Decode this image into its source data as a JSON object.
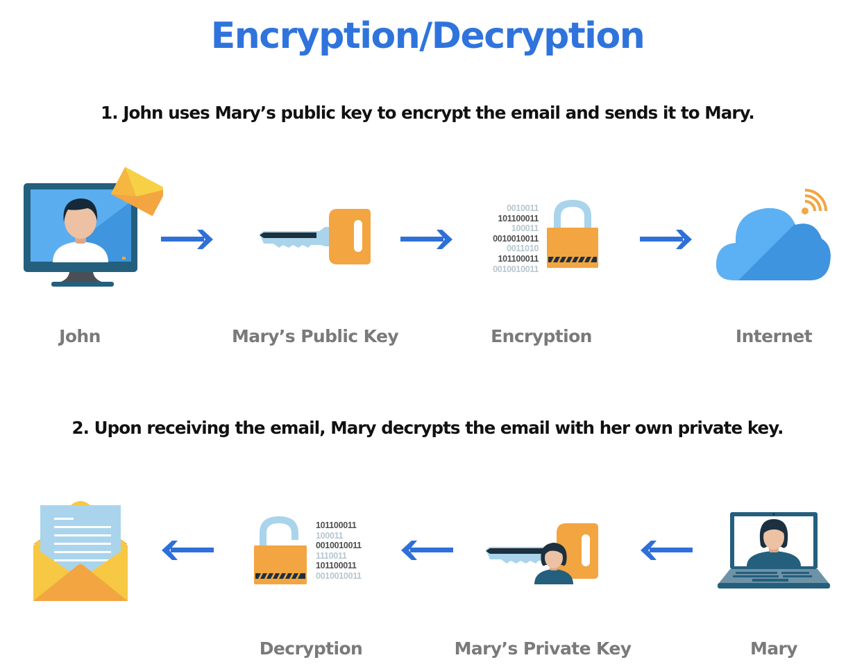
{
  "title": "Encryption/Decryption",
  "colors": {
    "title": "#2f74dc",
    "arrow": "#2f6fd8",
    "label": "#7a7a7a",
    "orange": "#f2a541",
    "yellow": "#f7c843",
    "light_blue": "#a9d4ec",
    "dark_teal": "#245f7d"
  },
  "step1": {
    "text": "1. John uses Mary’s public key to encrypt the email and sends it to Mary.",
    "nodes": [
      {
        "label": "John",
        "icon": "monitor-user-email-icon"
      },
      {
        "label": "Mary’s Public Key",
        "icon": "key-icon"
      },
      {
        "label": "Encryption",
        "icon": "locked-padlock-icon"
      },
      {
        "label": "Internet",
        "icon": "cloud-wifi-icon"
      }
    ],
    "arrow_direction": "right",
    "binary": [
      {
        "text": "0010011",
        "tone": "l"
      },
      {
        "text": "101100011",
        "tone": "d"
      },
      {
        "text": "100011",
        "tone": "l"
      },
      {
        "text": "0010010011",
        "tone": "d"
      },
      {
        "text": "0011010",
        "tone": "l"
      },
      {
        "text": "101100011",
        "tone": "d"
      },
      {
        "text": "0010010011",
        "tone": "l"
      }
    ]
  },
  "step2": {
    "text": "2. Upon receiving the email, Mary decrypts the email with her own private key.",
    "nodes": [
      {
        "label": "",
        "icon": "open-envelope-letter-icon"
      },
      {
        "label": "Decryption",
        "icon": "unlocked-padlock-icon"
      },
      {
        "label": "Mary’s Private Key",
        "icon": "key-with-user-icon"
      },
      {
        "label": "Mary",
        "icon": "laptop-user-icon"
      }
    ],
    "arrow_direction": "left",
    "binary": [
      {
        "text": "101100011",
        "tone": "d"
      },
      {
        "text": "100011",
        "tone": "l"
      },
      {
        "text": "0010010011",
        "tone": "d"
      },
      {
        "text": "1110011",
        "tone": "l"
      },
      {
        "text": "101100011",
        "tone": "d"
      },
      {
        "text": "0010010011",
        "tone": "l"
      }
    ]
  }
}
